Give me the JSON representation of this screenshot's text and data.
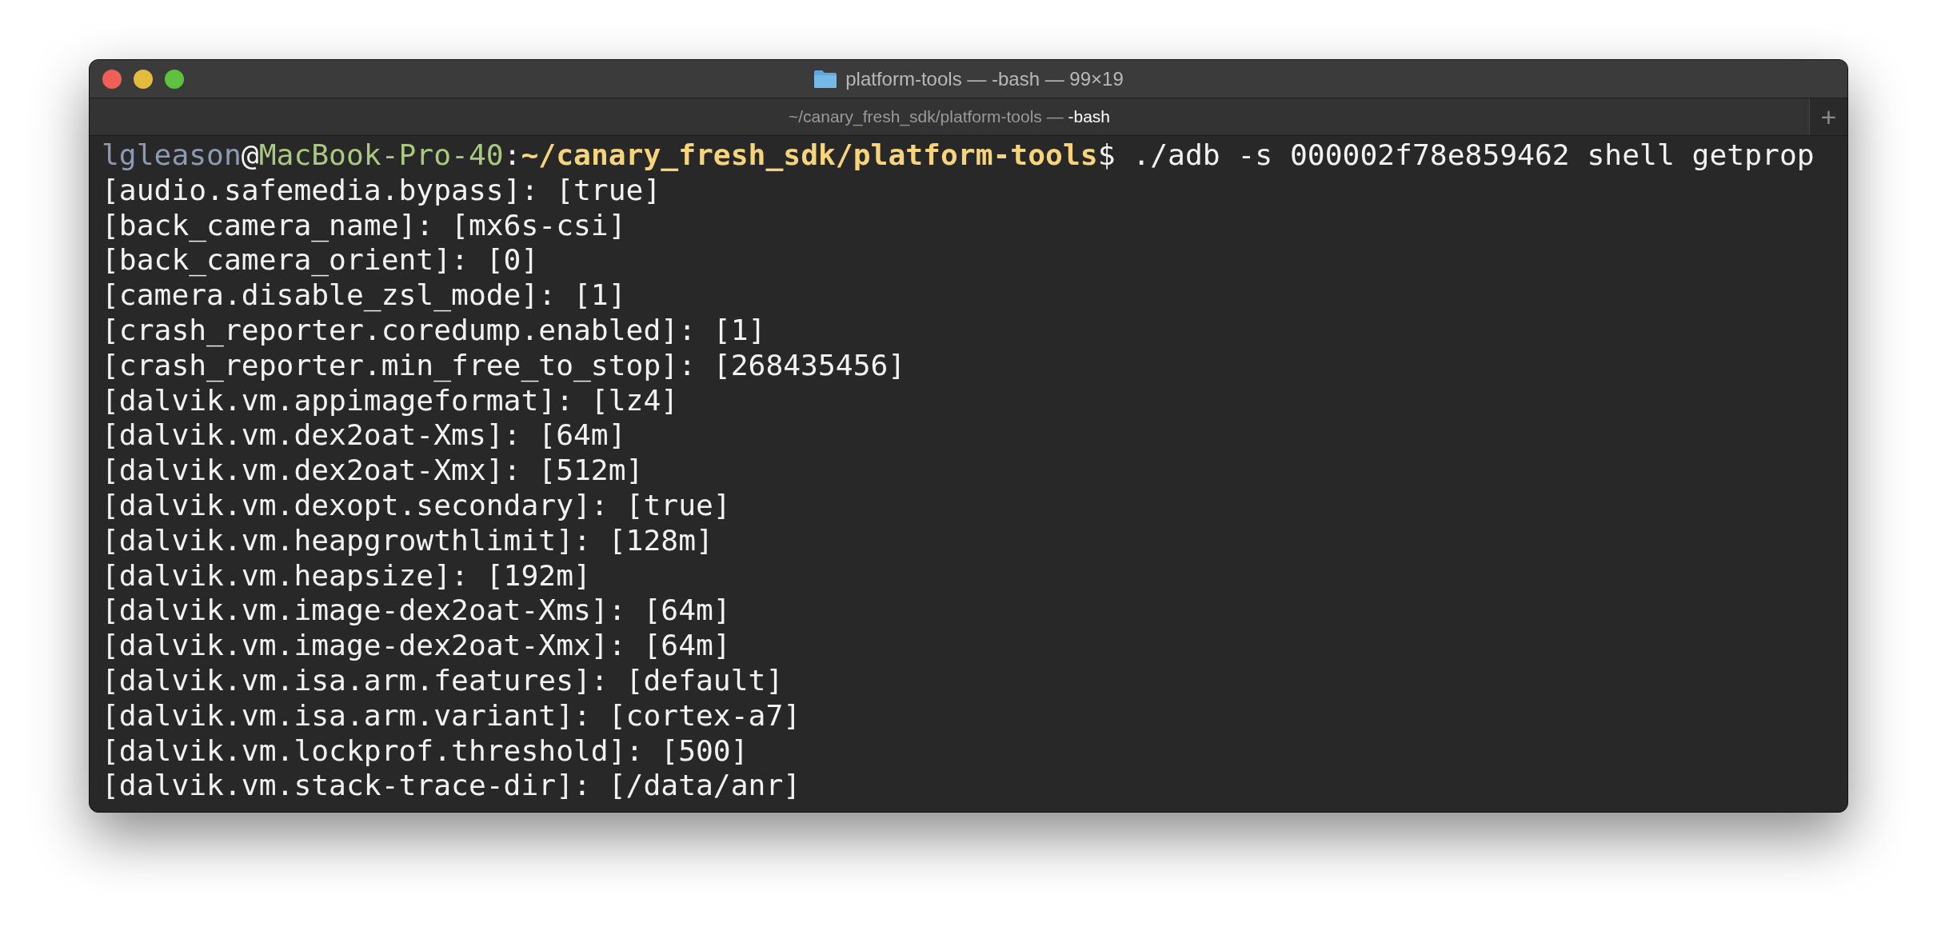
{
  "window": {
    "title": "platform-tools — -bash — 99×19"
  },
  "tabs": [
    {
      "path": "~/canary_fresh_sdk/platform-tools —",
      "process": "-bash",
      "selected": true
    }
  ],
  "new_tab": "+",
  "terminal": {
    "prompt": [
      {
        "kind": "user",
        "text": "lgleason"
      },
      {
        "kind": "plain",
        "text": "@"
      },
      {
        "kind": "host",
        "text": "MacBook-Pro-40"
      },
      {
        "kind": "plain",
        "text": ":"
      },
      {
        "kind": "cwd",
        "text": "~/canary_fresh_sdk/platform-tools"
      },
      {
        "kind": "plain",
        "text": "$ ./adb -s 000002f78e859462 shell getprop"
      }
    ],
    "output": [
      "[audio.safemedia.bypass]: [true]",
      "[back_camera_name]: [mx6s-csi]",
      "[back_camera_orient]: [0]",
      "[camera.disable_zsl_mode]: [1]",
      "[crash_reporter.coredump.enabled]: [1]",
      "[crash_reporter.min_free_to_stop]: [268435456]",
      "[dalvik.vm.appimageformat]: [lz4]",
      "[dalvik.vm.dex2oat-Xms]: [64m]",
      "[dalvik.vm.dex2oat-Xmx]: [512m]",
      "[dalvik.vm.dexopt.secondary]: [true]",
      "[dalvik.vm.heapgrowthlimit]: [128m]",
      "[dalvik.vm.heapsize]: [192m]",
      "[dalvik.vm.image-dex2oat-Xms]: [64m]",
      "[dalvik.vm.image-dex2oat-Xmx]: [64m]",
      "[dalvik.vm.isa.arm.features]: [default]",
      "[dalvik.vm.isa.arm.variant]: [cortex-a7]",
      "[dalvik.vm.lockprof.threshold]: [500]",
      "[dalvik.vm.stack-trace-dir]: [/data/anr]"
    ]
  }
}
